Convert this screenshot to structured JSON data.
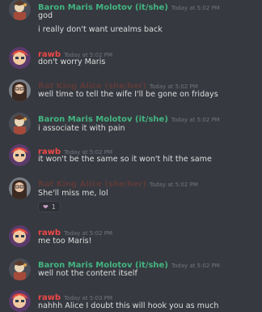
{
  "authors": {
    "baron": {
      "name": "Baron Maris Molotov (it/she)",
      "color": "#43b581"
    },
    "rawb": {
      "name": "rawb",
      "color": "#f04747"
    },
    "alice": {
      "name": "Rat King Alice (she/her)",
      "color": "#5d3a3a"
    }
  },
  "messages": [
    {
      "author": "Baron Maris Molotov (it/she)",
      "timestamp": "Today at 5:02 PM",
      "lines": [
        "god",
        "i really don't want urealms back"
      ]
    },
    {
      "author": "rawb",
      "timestamp": "Today at 5:02 PM",
      "lines": [
        "don't worry Maris"
      ]
    },
    {
      "author": "Rat King Alice (she/her)",
      "timestamp": "Today at 5:02 PM",
      "lines": [
        "well time to tell the wife I'll be gone on fridays"
      ]
    },
    {
      "author": "Baron Maris Molotov (it/she)",
      "timestamp": "Today at 5:02 PM",
      "lines": [
        "i associate it with pain"
      ]
    },
    {
      "author": "rawb",
      "timestamp": "Today at 5:02 PM",
      "lines": [
        "it won't be the same so it won't hit the same"
      ]
    },
    {
      "author": "Rat King Alice (she/her)",
      "timestamp": "Today at 5:02 PM",
      "lines": [
        "She'll miss me, lol"
      ],
      "reaction": {
        "icon": "heart-emoji-icon",
        "glyph": "❤",
        "count": "1"
      }
    },
    {
      "author": "rawb",
      "timestamp": "Today at 5:02 PM",
      "lines": [
        "me too Maris!"
      ]
    },
    {
      "author": "Baron Maris Molotov (it/she)",
      "timestamp": "Today at 5:02 PM",
      "lines": [
        "well not the content itself"
      ]
    },
    {
      "author": "rawb",
      "timestamp": "Today at 5:03 PM",
      "lines": [
        "nahhh Alice I doubt this will hook you as much"
      ]
    }
  ]
}
